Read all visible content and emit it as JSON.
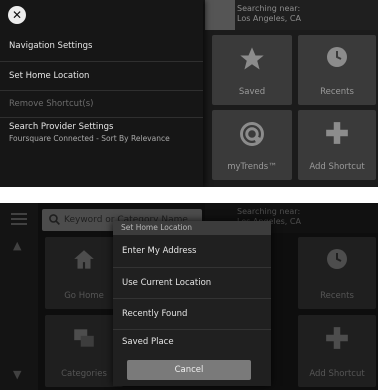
{
  "top": {
    "searching": {
      "label": "Searching near:",
      "location": "Los Angeles, CA"
    },
    "tiles": {
      "saved": "Saved",
      "recents": "Recents",
      "mytrends": "myTrends™",
      "add_shortcut": "Add Shortcut"
    },
    "menu": {
      "close_glyph": "✕",
      "items": [
        {
          "label": "Navigation Settings"
        },
        {
          "label": "Set Home Location"
        },
        {
          "label": "Remove Shortcut(s)"
        },
        {
          "label": "Search Provider Settings",
          "sub": "Foursquare Connected - Sort By Relevance"
        }
      ]
    }
  },
  "bottom": {
    "search_placeholder": "Keyword or Category Name",
    "searching": {
      "label": "Searching near:",
      "location": "Los Angeles, CA"
    },
    "tiles": {
      "go_home": "Go Home",
      "recents": "Recents",
      "categories": "Categories",
      "add_shortcut": "Add Shortcut"
    },
    "popup": {
      "title": "Set Home Location",
      "items": [
        {
          "label": "Enter My Address"
        },
        {
          "label": "Use Current Location"
        },
        {
          "label": "Recently Found"
        },
        {
          "label": "Saved Place"
        }
      ],
      "cancel": "Cancel"
    }
  }
}
